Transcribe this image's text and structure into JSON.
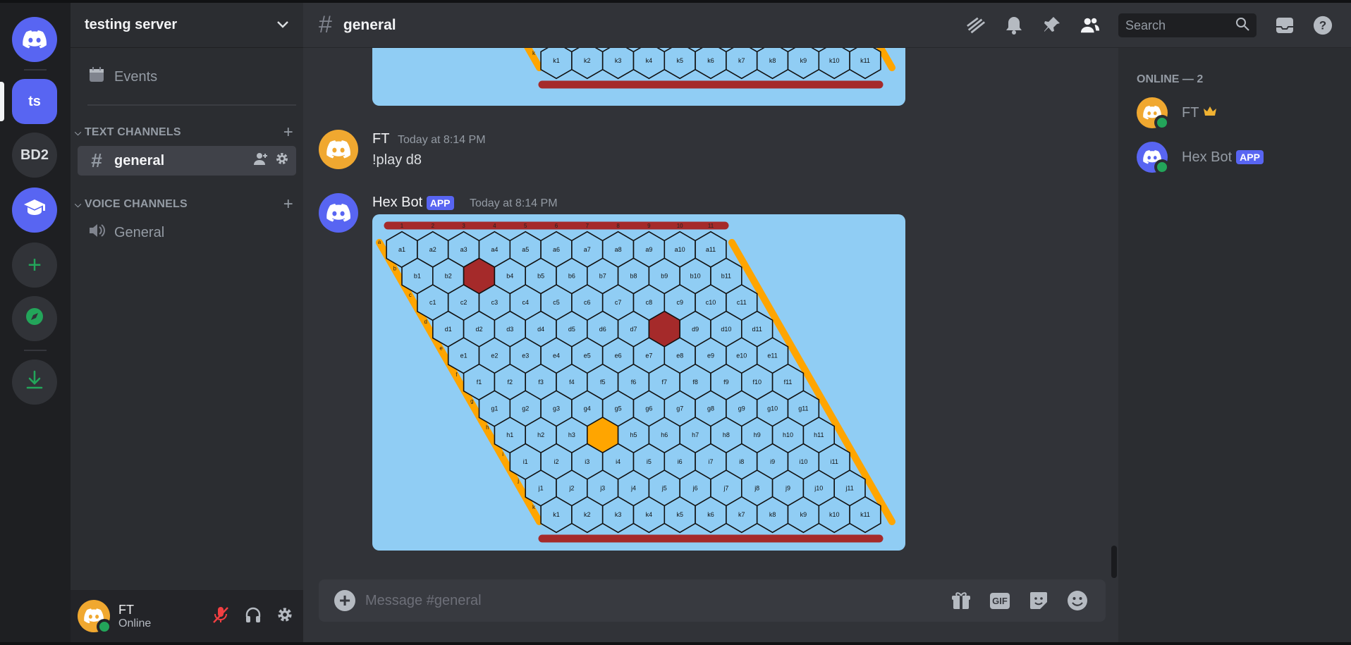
{
  "server": {
    "name": "testing server",
    "rail": {
      "abbrev_active": "ts",
      "abbrev_other": "BD2"
    }
  },
  "sidebar": {
    "events_label": "Events",
    "text_category": "TEXT CHANNELS",
    "voice_category": "VOICE CHANNELS",
    "text_channel": "general",
    "voice_channel": "General"
  },
  "user_panel": {
    "name": "FT",
    "status": "Online"
  },
  "channel_header": {
    "title": "general",
    "search_placeholder": "Search"
  },
  "messages": [
    {
      "author": "FT",
      "timestamp": "Today at 8:14 PM",
      "text": "!play d8"
    },
    {
      "author": "Hex Bot",
      "badge": "APP",
      "timestamp": "Today at 8:14 PM"
    }
  ],
  "board": {
    "columns": [
      "1",
      "2",
      "3",
      "4",
      "5",
      "6",
      "7",
      "8",
      "9",
      "10",
      "11"
    ],
    "rows": [
      "a",
      "b",
      "c",
      "d",
      "e",
      "f",
      "g",
      "h",
      "i",
      "j",
      "k"
    ],
    "red_cells": [
      "b3",
      "d8"
    ],
    "orange_cells": [
      "h4"
    ],
    "colors": {
      "red": "#a52a2a",
      "orange": "#ffa500",
      "cell": "#90cdf4",
      "stroke": "#111111"
    }
  },
  "composer": {
    "placeholder": "Message #general",
    "gif_label": "GIF"
  },
  "member_list": {
    "header": "ONLINE — 2",
    "members": [
      {
        "name": "FT"
      },
      {
        "name": "Hex Bot",
        "badge": "APP"
      }
    ]
  },
  "colors": {
    "blurple": "#5865f2",
    "online": "#23a55a",
    "avatar_orange": "#f0a830"
  }
}
